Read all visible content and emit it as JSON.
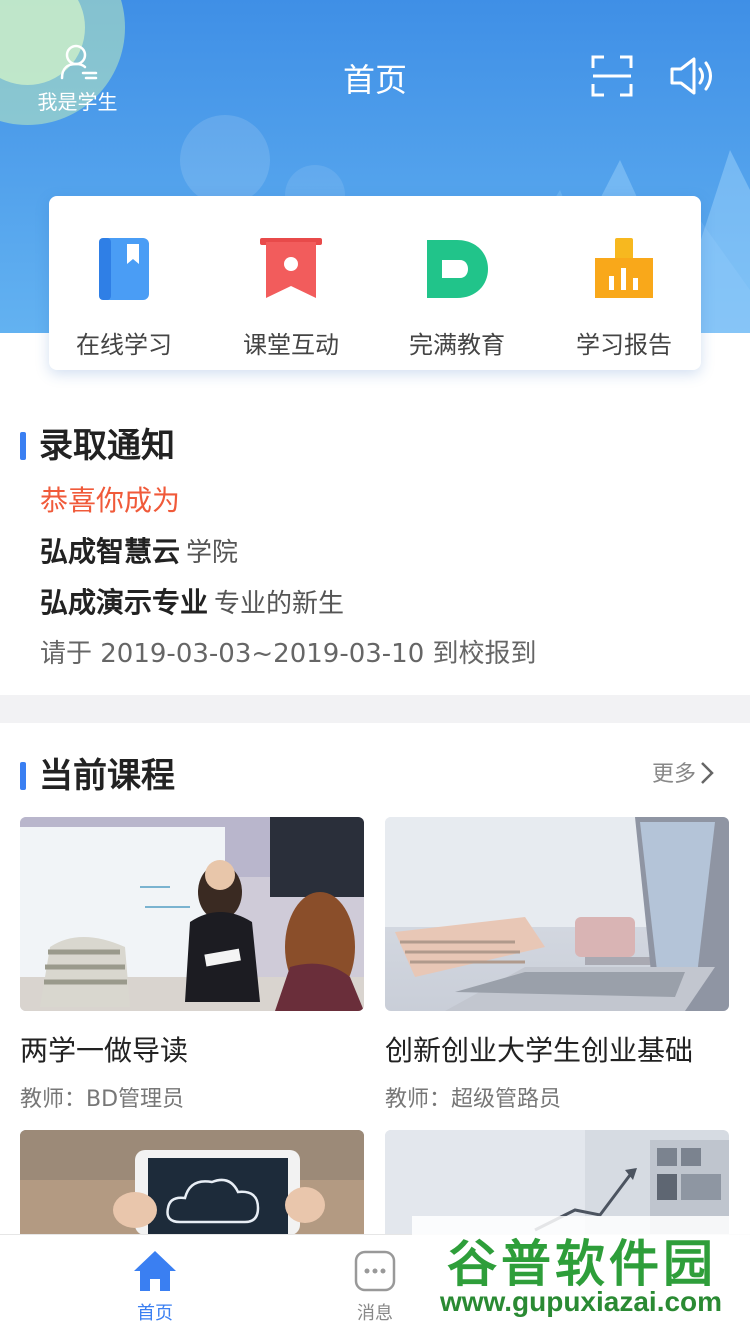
{
  "header": {
    "title": "首页",
    "student_label": "我是学生"
  },
  "quick_actions": [
    {
      "label": "在线学习",
      "icon": "book-icon"
    },
    {
      "label": "课堂互动",
      "icon": "banner-icon"
    },
    {
      "label": "完满教育",
      "icon": "d-logo-icon"
    },
    {
      "label": "学习报告",
      "icon": "bar-chart-icon"
    }
  ],
  "admission": {
    "title": "录取通知",
    "congrats": "恭喜你成为",
    "school_name": "弘成智慧云",
    "school_suffix": "学院",
    "major_name": "弘成演示专业",
    "major_suffix": "专业的新生",
    "report_text": "请于 2019-03-03~2019-03-10 到校报到"
  },
  "courses": {
    "title": "当前课程",
    "more_label": "更多",
    "items": [
      {
        "name": "两学一做导读",
        "teacher": "教师：BD管理员"
      },
      {
        "name": "创新创业大学生创业基础",
        "teacher": "教师：超级管路员"
      }
    ]
  },
  "tabbar": {
    "items": [
      {
        "label": "首页",
        "active": true
      },
      {
        "label": "消息",
        "active": false
      }
    ]
  },
  "watermark": {
    "logo": "谷普软件园",
    "url": "www.gupuxiazai.com"
  },
  "colors": {
    "primary_blue": "#3a7ff2",
    "hero_blue": "#4a9ae9",
    "accent_red": "#f05a3a",
    "watermark_green": "#2e9e3a"
  }
}
